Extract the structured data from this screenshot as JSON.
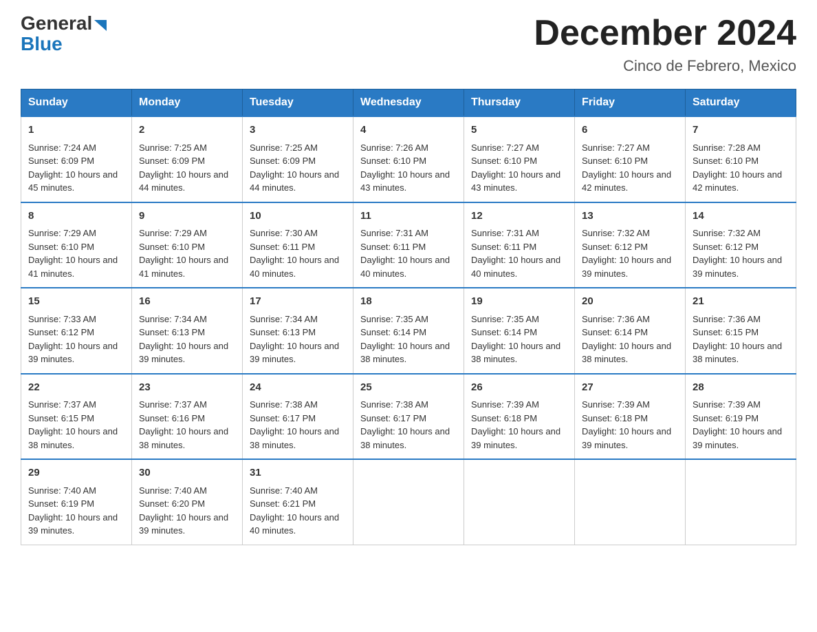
{
  "header": {
    "logo_general": "General",
    "logo_blue": "Blue",
    "title": "December 2024",
    "location": "Cinco de Febrero, Mexico"
  },
  "days_of_week": [
    "Sunday",
    "Monday",
    "Tuesday",
    "Wednesday",
    "Thursday",
    "Friday",
    "Saturday"
  ],
  "weeks": [
    [
      {
        "day": "1",
        "sunrise": "7:24 AM",
        "sunset": "6:09 PM",
        "daylight": "10 hours and 45 minutes."
      },
      {
        "day": "2",
        "sunrise": "7:25 AM",
        "sunset": "6:09 PM",
        "daylight": "10 hours and 44 minutes."
      },
      {
        "day": "3",
        "sunrise": "7:25 AM",
        "sunset": "6:09 PM",
        "daylight": "10 hours and 44 minutes."
      },
      {
        "day": "4",
        "sunrise": "7:26 AM",
        "sunset": "6:10 PM",
        "daylight": "10 hours and 43 minutes."
      },
      {
        "day": "5",
        "sunrise": "7:27 AM",
        "sunset": "6:10 PM",
        "daylight": "10 hours and 43 minutes."
      },
      {
        "day": "6",
        "sunrise": "7:27 AM",
        "sunset": "6:10 PM",
        "daylight": "10 hours and 42 minutes."
      },
      {
        "day": "7",
        "sunrise": "7:28 AM",
        "sunset": "6:10 PM",
        "daylight": "10 hours and 42 minutes."
      }
    ],
    [
      {
        "day": "8",
        "sunrise": "7:29 AM",
        "sunset": "6:10 PM",
        "daylight": "10 hours and 41 minutes."
      },
      {
        "day": "9",
        "sunrise": "7:29 AM",
        "sunset": "6:10 PM",
        "daylight": "10 hours and 41 minutes."
      },
      {
        "day": "10",
        "sunrise": "7:30 AM",
        "sunset": "6:11 PM",
        "daylight": "10 hours and 40 minutes."
      },
      {
        "day": "11",
        "sunrise": "7:31 AM",
        "sunset": "6:11 PM",
        "daylight": "10 hours and 40 minutes."
      },
      {
        "day": "12",
        "sunrise": "7:31 AM",
        "sunset": "6:11 PM",
        "daylight": "10 hours and 40 minutes."
      },
      {
        "day": "13",
        "sunrise": "7:32 AM",
        "sunset": "6:12 PM",
        "daylight": "10 hours and 39 minutes."
      },
      {
        "day": "14",
        "sunrise": "7:32 AM",
        "sunset": "6:12 PM",
        "daylight": "10 hours and 39 minutes."
      }
    ],
    [
      {
        "day": "15",
        "sunrise": "7:33 AM",
        "sunset": "6:12 PM",
        "daylight": "10 hours and 39 minutes."
      },
      {
        "day": "16",
        "sunrise": "7:34 AM",
        "sunset": "6:13 PM",
        "daylight": "10 hours and 39 minutes."
      },
      {
        "day": "17",
        "sunrise": "7:34 AM",
        "sunset": "6:13 PM",
        "daylight": "10 hours and 39 minutes."
      },
      {
        "day": "18",
        "sunrise": "7:35 AM",
        "sunset": "6:14 PM",
        "daylight": "10 hours and 38 minutes."
      },
      {
        "day": "19",
        "sunrise": "7:35 AM",
        "sunset": "6:14 PM",
        "daylight": "10 hours and 38 minutes."
      },
      {
        "day": "20",
        "sunrise": "7:36 AM",
        "sunset": "6:14 PM",
        "daylight": "10 hours and 38 minutes."
      },
      {
        "day": "21",
        "sunrise": "7:36 AM",
        "sunset": "6:15 PM",
        "daylight": "10 hours and 38 minutes."
      }
    ],
    [
      {
        "day": "22",
        "sunrise": "7:37 AM",
        "sunset": "6:15 PM",
        "daylight": "10 hours and 38 minutes."
      },
      {
        "day": "23",
        "sunrise": "7:37 AM",
        "sunset": "6:16 PM",
        "daylight": "10 hours and 38 minutes."
      },
      {
        "day": "24",
        "sunrise": "7:38 AM",
        "sunset": "6:17 PM",
        "daylight": "10 hours and 38 minutes."
      },
      {
        "day": "25",
        "sunrise": "7:38 AM",
        "sunset": "6:17 PM",
        "daylight": "10 hours and 38 minutes."
      },
      {
        "day": "26",
        "sunrise": "7:39 AM",
        "sunset": "6:18 PM",
        "daylight": "10 hours and 39 minutes."
      },
      {
        "day": "27",
        "sunrise": "7:39 AM",
        "sunset": "6:18 PM",
        "daylight": "10 hours and 39 minutes."
      },
      {
        "day": "28",
        "sunrise": "7:39 AM",
        "sunset": "6:19 PM",
        "daylight": "10 hours and 39 minutes."
      }
    ],
    [
      {
        "day": "29",
        "sunrise": "7:40 AM",
        "sunset": "6:19 PM",
        "daylight": "10 hours and 39 minutes."
      },
      {
        "day": "30",
        "sunrise": "7:40 AM",
        "sunset": "6:20 PM",
        "daylight": "10 hours and 39 minutes."
      },
      {
        "day": "31",
        "sunrise": "7:40 AM",
        "sunset": "6:21 PM",
        "daylight": "10 hours and 40 minutes."
      },
      null,
      null,
      null,
      null
    ]
  ],
  "labels": {
    "sunrise_prefix": "Sunrise: ",
    "sunset_prefix": "Sunset: ",
    "daylight_prefix": "Daylight: "
  }
}
